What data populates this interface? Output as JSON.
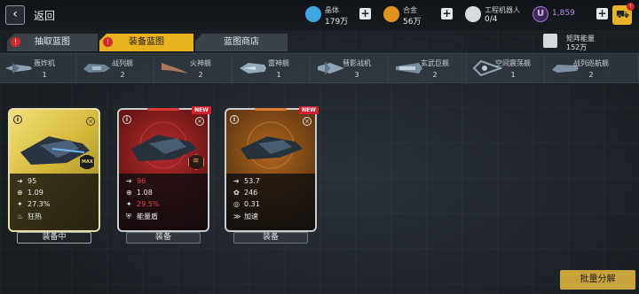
{
  "topbar": {
    "back_label": "返回",
    "crystal": {
      "name": "晶体",
      "value": "179万",
      "color": "#3fa6e6"
    },
    "alloy": {
      "name": "合金",
      "value": "56万",
      "color": "#e0941c"
    },
    "robot": {
      "name": "工程机器人",
      "value": "0/4"
    },
    "credits": {
      "value": "1,859",
      "color": "#b06be0"
    }
  },
  "tabs": [
    {
      "label": "抽取蓝图",
      "badge": "!"
    },
    {
      "label": "装备蓝图",
      "badge": "!"
    },
    {
      "label": "蓝图商店"
    }
  ],
  "matrix": {
    "name": "矩阵能量",
    "value": "152万"
  },
  "ship_types": [
    {
      "name": "轰炸机",
      "count": "1"
    },
    {
      "name": "战列舰",
      "count": "2"
    },
    {
      "name": "火神舰",
      "count": "2"
    },
    {
      "name": "雷神舰",
      "count": "1"
    },
    {
      "name": "彗影战机",
      "count": "3"
    },
    {
      "name": "玄武巨舰",
      "count": "2"
    },
    {
      "name": "空间震荡舰",
      "count": "1"
    },
    {
      "name": "战列巡航舰",
      "count": "2"
    }
  ],
  "cards": [
    {
      "stats": [
        {
          "icon": "➜",
          "value": "95"
        },
        {
          "icon": "⊕",
          "value": "1.09"
        },
        {
          "icon": "✦",
          "value": "27.3%"
        },
        {
          "icon": "♨",
          "value": "狂热"
        }
      ],
      "tier_label": "MAX",
      "button": "装备中"
    },
    {
      "new_label": "NEW",
      "stats": [
        {
          "icon": "➜",
          "value": "96"
        },
        {
          "icon": "⊕",
          "value": "1.08"
        },
        {
          "icon": "✦",
          "value": "29.5%"
        },
        {
          "icon": "⛨",
          "value": "能量盾"
        }
      ],
      "button": "装备"
    },
    {
      "new_label": "NEW",
      "stats": [
        {
          "icon": "➜",
          "value": "53.7"
        },
        {
          "icon": "✿",
          "value": "246"
        },
        {
          "icon": "◎",
          "value": "0.31"
        },
        {
          "icon": "≫",
          "value": "加速"
        }
      ],
      "button": "装备"
    }
  ],
  "bulk_button": "批量分解"
}
